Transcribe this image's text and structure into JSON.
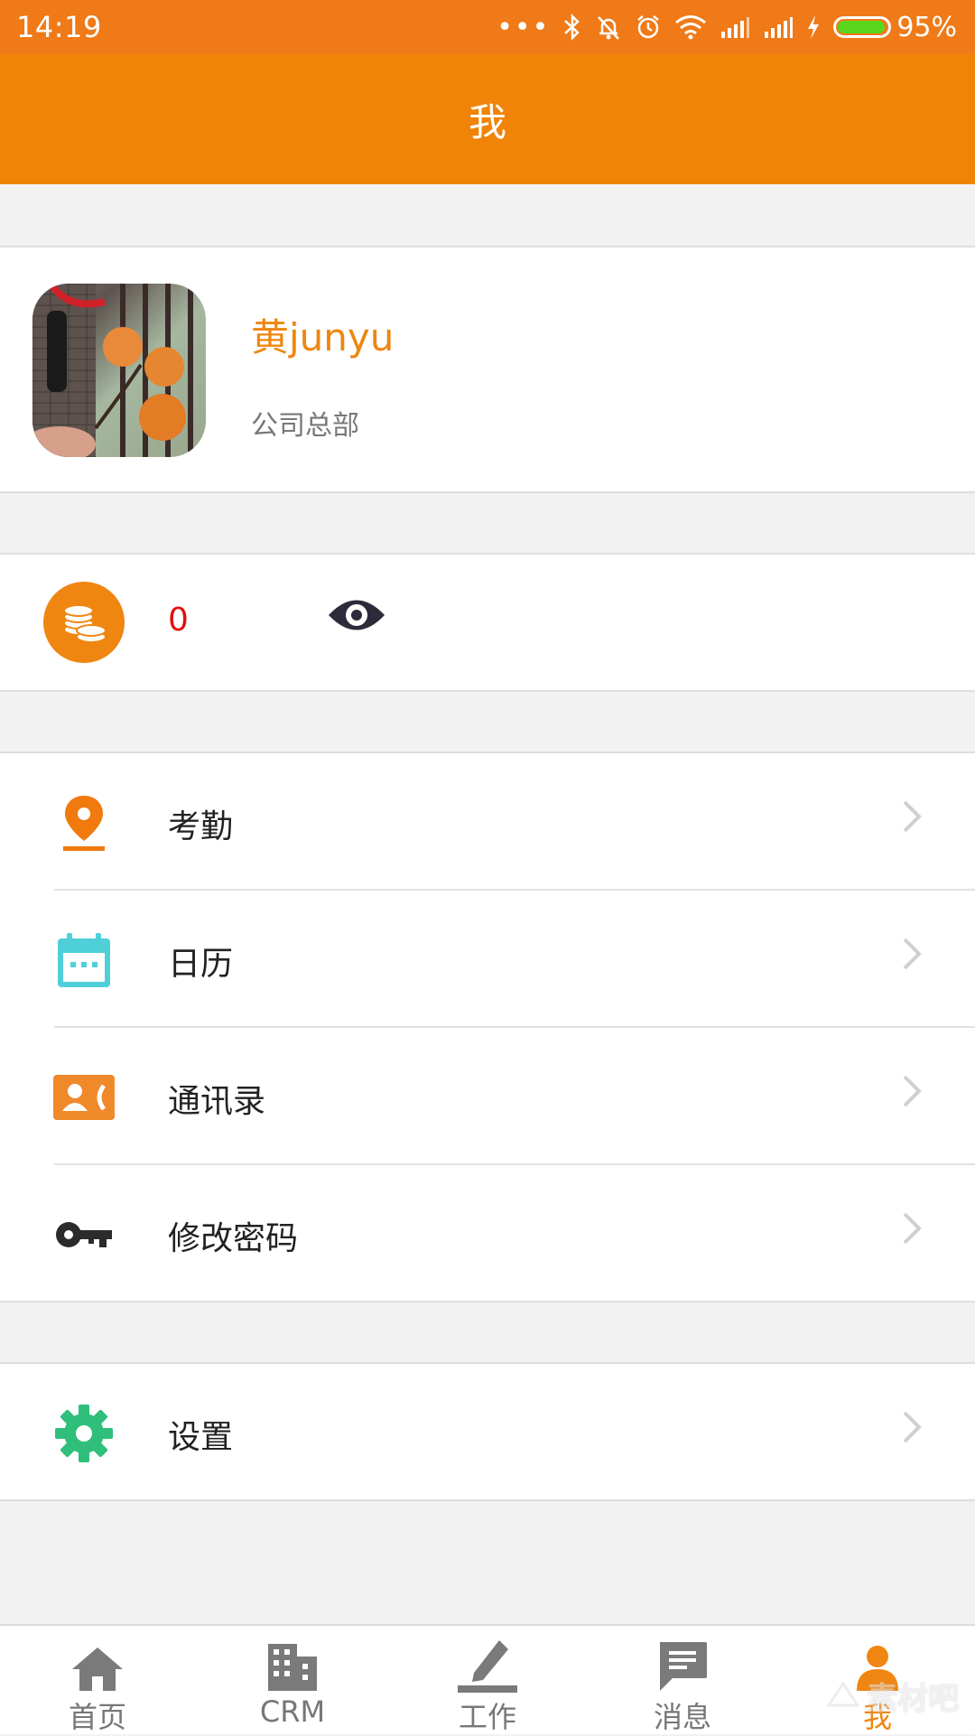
{
  "status_bar": {
    "time": "14:19",
    "battery": "95%"
  },
  "header": {
    "title": "我"
  },
  "profile": {
    "name": "黄junyu",
    "department": "公司总部"
  },
  "points": {
    "value": "0"
  },
  "menu": {
    "items": [
      {
        "label": "考勤",
        "icon": "location-pin-icon"
      },
      {
        "label": "日历",
        "icon": "calendar-icon"
      },
      {
        "label": "通讯录",
        "icon": "contacts-card-icon"
      },
      {
        "label": "修改密码",
        "icon": "key-icon"
      }
    ]
  },
  "settings": {
    "label": "设置",
    "icon": "gear-icon"
  },
  "tabs": [
    {
      "label": "首页",
      "icon": "home-icon"
    },
    {
      "label": "CRM",
      "icon": "building-icon"
    },
    {
      "label": "工作",
      "icon": "pencil-icon"
    },
    {
      "label": "消息",
      "icon": "message-icon"
    },
    {
      "label": "我",
      "icon": "person-icon",
      "active": true
    }
  ],
  "watermark": {
    "text": "素材吧"
  },
  "colors": {
    "accent": "#f08408",
    "status_bar": "#ef7a17",
    "points_value": "#e01010",
    "location": "#f07a0e",
    "calendar": "#4fd0d9",
    "contacts": "#f0892a",
    "settings": "#2fbf7a"
  }
}
